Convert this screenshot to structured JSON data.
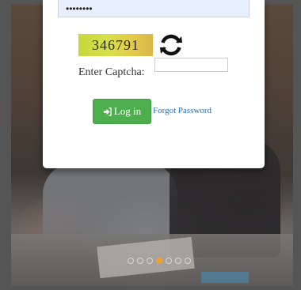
{
  "login": {
    "password_value": "••••••••",
    "captcha_code": "346791",
    "captcha_label": "Enter Captcha:",
    "captcha_input_value": "",
    "login_button_label": "Log in",
    "forgot_password_label": "Forgot Password"
  },
  "carousel": {
    "slide_count": 7,
    "active_slide": 4
  },
  "colors": {
    "login_button": "#4cae4c",
    "link": "#2a6db5",
    "active_dot": "#f0a030"
  }
}
